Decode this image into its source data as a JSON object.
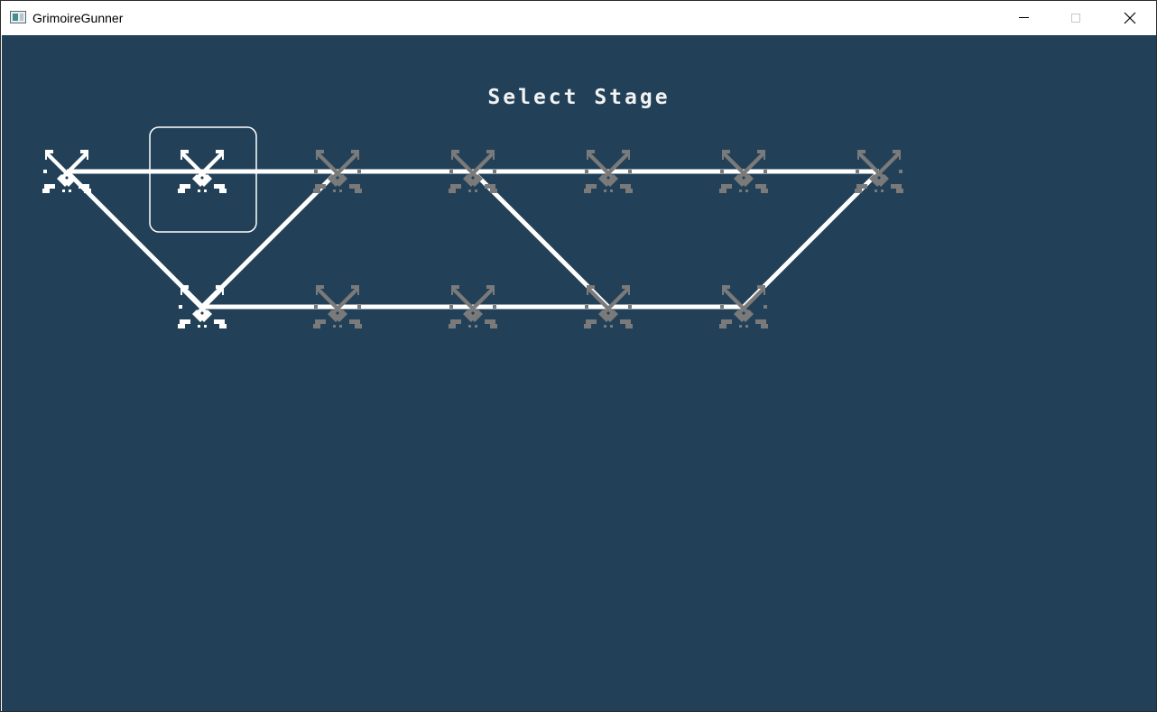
{
  "window": {
    "title": "GrimoireGunner",
    "app_icon": "app-window-icon",
    "controls": {
      "minimize_icon": "minimize-icon",
      "maximize_icon": "maximize-icon",
      "close_icon": "close-icon"
    }
  },
  "screen": {
    "heading": "Select Stage",
    "background_color": "#224158",
    "unlocked_color": "#ffffff",
    "locked_color": "#7a7a7a",
    "path_color": "#ffffff",
    "node_icon": "crossed-swords-icon",
    "selected_stage": "r1c2"
  },
  "stages": [
    {
      "id": "r1c1",
      "row": 1,
      "col": 1,
      "unlocked": true
    },
    {
      "id": "r1c2",
      "row": 1,
      "col": 2,
      "unlocked": true
    },
    {
      "id": "r1c3",
      "row": 1,
      "col": 3,
      "unlocked": false
    },
    {
      "id": "r1c4",
      "row": 1,
      "col": 4,
      "unlocked": false
    },
    {
      "id": "r1c5",
      "row": 1,
      "col": 5,
      "unlocked": false
    },
    {
      "id": "r1c6",
      "row": 1,
      "col": 6,
      "unlocked": false
    },
    {
      "id": "r1c7",
      "row": 1,
      "col": 7,
      "unlocked": false
    },
    {
      "id": "r2c2",
      "row": 2,
      "col": 2,
      "unlocked": true
    },
    {
      "id": "r2c3",
      "row": 2,
      "col": 3,
      "unlocked": false
    },
    {
      "id": "r2c4",
      "row": 2,
      "col": 4,
      "unlocked": false
    },
    {
      "id": "r2c5",
      "row": 2,
      "col": 5,
      "unlocked": false
    },
    {
      "id": "r2c6",
      "row": 2,
      "col": 6,
      "unlocked": false
    }
  ],
  "paths": [
    [
      "r1c1",
      "r1c2"
    ],
    [
      "r1c2",
      "r1c3"
    ],
    [
      "r1c3",
      "r1c4"
    ],
    [
      "r1c4",
      "r1c5"
    ],
    [
      "r1c5",
      "r1c6"
    ],
    [
      "r1c6",
      "r1c7"
    ],
    [
      "r1c1",
      "r2c2"
    ],
    [
      "r2c2",
      "r1c3"
    ],
    [
      "r1c4",
      "r2c5"
    ],
    [
      "r2c6",
      "r1c7"
    ],
    [
      "r2c2",
      "r2c3"
    ],
    [
      "r2c3",
      "r2c4"
    ],
    [
      "r2c4",
      "r2c5"
    ],
    [
      "r2c5",
      "r2c6"
    ]
  ]
}
